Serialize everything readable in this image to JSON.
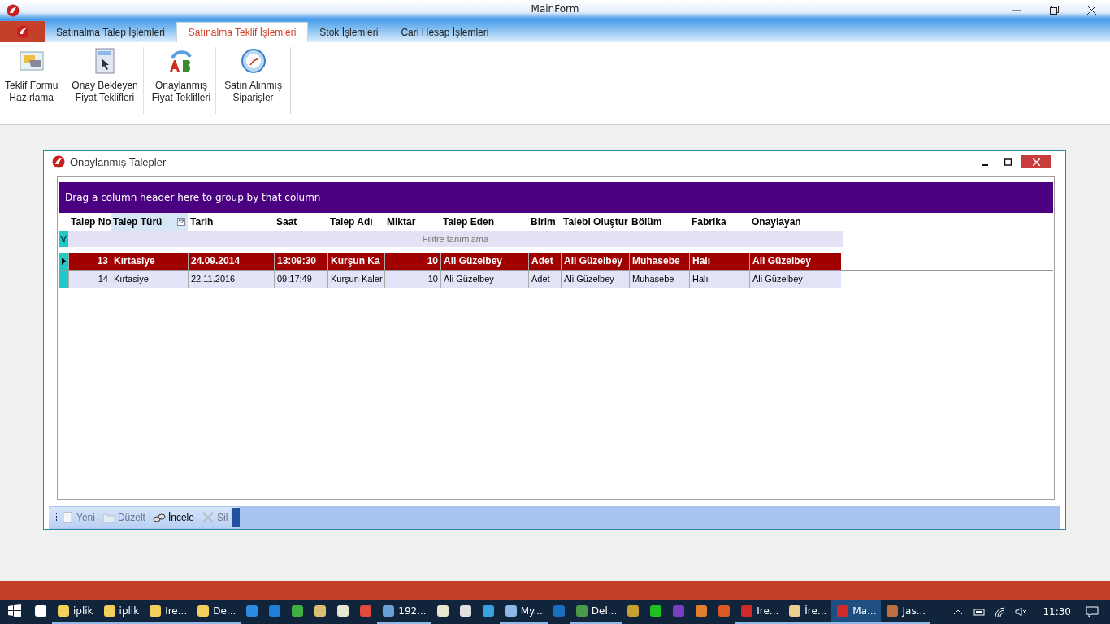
{
  "window": {
    "title": "MainForm"
  },
  "ribbon": {
    "tabs": [
      {
        "label": "Satınalma Talep İşlemleri",
        "selected": false
      },
      {
        "label": "Satınalma Teklif İşlemleri",
        "selected": true
      },
      {
        "label": "Stok İşlemleri",
        "selected": false
      },
      {
        "label": "Cari Hesap İşlemleri",
        "selected": false
      }
    ],
    "buttons": [
      {
        "label": "Teklif Formu\nHazırlama",
        "kind": "form"
      },
      {
        "label": "Onay Bekleyen\nFiyat Teklifleri",
        "kind": "cursor"
      },
      {
        "label": "Onaylanmış\nFiyat Teklifleri",
        "kind": "ab"
      },
      {
        "label": "Satın Alınmış\nSiparişler",
        "kind": "clock"
      }
    ]
  },
  "child_window": {
    "title": "Onaylanmış Talepler",
    "group_panel": "Drag a column header here to group by that column",
    "columns": [
      {
        "label": "Talep No",
        "selected": false
      },
      {
        "label": "Talep Türü",
        "selected": true
      },
      {
        "label": "Tarih",
        "selected": false
      },
      {
        "label": "Saat",
        "selected": false
      },
      {
        "label": "Talep Adı",
        "selected": false
      },
      {
        "label": "Miktar",
        "selected": false
      },
      {
        "label": "Talep Eden",
        "selected": false
      },
      {
        "label": "Birim",
        "selected": false
      },
      {
        "label": "Talebi Oluştur",
        "selected": false
      },
      {
        "label": "Bölüm",
        "selected": false
      },
      {
        "label": "Fabrika",
        "selected": false
      },
      {
        "label": "Onaylayan",
        "selected": false
      }
    ],
    "filter_row": "Filitre tanımlama",
    "rows": [
      {
        "selected": true,
        "cells": [
          "13",
          "Kırtasiye",
          "24.09.2014",
          "13:09:30",
          "Kurşun Ka",
          "10",
          "Ali Güzelbey",
          "Adet",
          "Ali Güzelbey",
          "Muhasebe",
          "Halı",
          "Ali Güzelbey"
        ]
      },
      {
        "selected": false,
        "cells": [
          "14",
          "Kırtasiye",
          "22.11.2016",
          "09:17:49",
          "Kurşun Kaler",
          "10",
          "Ali Güzelbey",
          "Adet",
          "Ali Güzelbey",
          "Muhasebe",
          "Halı",
          "Ali Güzelbey"
        ]
      }
    ],
    "toolbar": [
      {
        "label": "Yeni",
        "disabled": true,
        "kind": "new"
      },
      {
        "label": "Düzelt",
        "disabled": true,
        "kind": "edit"
      },
      {
        "label": "İncele",
        "disabled": false,
        "kind": "view"
      },
      {
        "label": "Sil",
        "disabled": true,
        "kind": "delete"
      }
    ]
  },
  "taskbar": {
    "items": [
      {
        "kind": "store",
        "running": false,
        "selected": false
      },
      {
        "kind": "folder",
        "label": "iplik",
        "running": true,
        "selected": false
      },
      {
        "kind": "folder",
        "label": "iplik",
        "running": true,
        "selected": false
      },
      {
        "kind": "folder",
        "label": "Ire...",
        "running": true,
        "selected": false
      },
      {
        "kind": "folder",
        "label": "De...",
        "running": true,
        "selected": false
      },
      {
        "kind": "ie",
        "running": false,
        "selected": false
      },
      {
        "kind": "edge",
        "running": false,
        "selected": false
      },
      {
        "kind": "check",
        "running": false,
        "selected": false
      },
      {
        "kind": "tool",
        "running": false,
        "selected": false
      },
      {
        "kind": "note",
        "running": false,
        "selected": false
      },
      {
        "kind": "chrome",
        "running": false,
        "selected": false
      },
      {
        "kind": "remote",
        "label": "192...",
        "running": true,
        "selected": false
      },
      {
        "kind": "note",
        "running": false,
        "selected": false
      },
      {
        "kind": "calc",
        "running": false,
        "selected": false
      },
      {
        "kind": "media",
        "running": false,
        "selected": false
      },
      {
        "kind": "bolt",
        "label": "My...",
        "running": true,
        "selected": false
      },
      {
        "kind": "outlook",
        "running": false,
        "selected": false
      },
      {
        "kind": "globe",
        "label": "Del...",
        "running": true,
        "selected": false
      },
      {
        "kind": "seven",
        "running": false,
        "selected": false
      },
      {
        "kind": "ball",
        "running": false,
        "selected": false
      },
      {
        "kind": "vs",
        "running": false,
        "selected": false
      },
      {
        "kind": "gadget",
        "running": false,
        "selected": false
      },
      {
        "kind": "app",
        "running": false,
        "selected": false
      },
      {
        "kind": "red",
        "label": "Ire...",
        "running": true,
        "selected": false
      },
      {
        "kind": "info",
        "label": "İre...",
        "running": true,
        "selected": false
      },
      {
        "kind": "red",
        "label": "Ma...",
        "running": true,
        "selected": true
      },
      {
        "kind": "paint",
        "label": "Jas...",
        "running": true,
        "selected": false
      }
    ],
    "clock": "11:30"
  }
}
